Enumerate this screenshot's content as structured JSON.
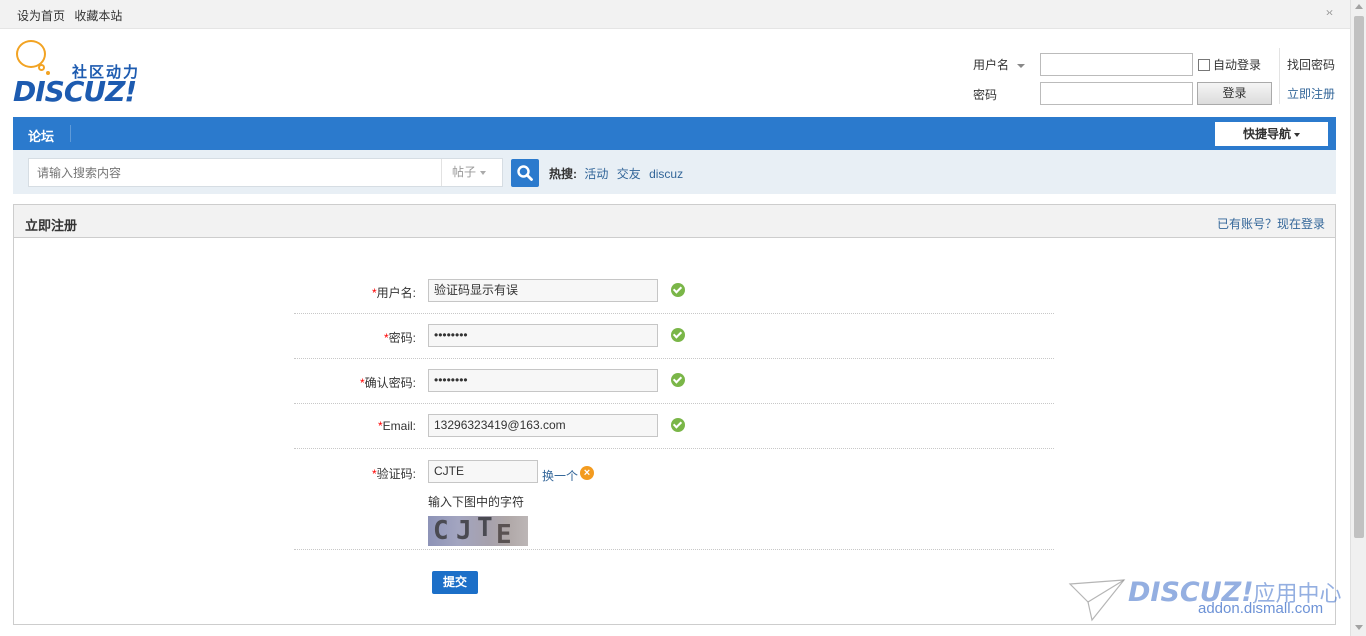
{
  "topbar": {
    "links": [
      "设为首页",
      "收藏本站"
    ],
    "collapse_glyph": "›‹"
  },
  "logo": {
    "cn_text": "社区动力",
    "en_text": "DISCUZ!",
    "brand_color": "#1d5bb0",
    "bubble_color": "#f2a323"
  },
  "login": {
    "username_label": "用户名",
    "password_label": "密码",
    "username_value": "",
    "password_value": "",
    "auto_login_label": "自动登录",
    "login_button": "登录",
    "find_password": "找回密码",
    "register_link": "立即注册"
  },
  "nav": {
    "forum_label": "论坛",
    "quick_nav_label": "快捷导航",
    "bg_color": "#2b7acd"
  },
  "search": {
    "placeholder": "请输入搜索内容",
    "type_label": "帖子",
    "hot_label": "热搜:",
    "hot_links": [
      "活动",
      "交友",
      "discuz"
    ]
  },
  "register": {
    "title": "立即注册",
    "have_account": "已有账号？现在登录",
    "fields": {
      "username": {
        "label": "用户名:",
        "value": "验证码显示有误"
      },
      "password": {
        "label": "密码:",
        "value": "••••••••"
      },
      "confirm": {
        "label": "确认密码:",
        "value": "••••••••"
      },
      "email": {
        "label": "Email:",
        "value": "13296323419@163.com"
      },
      "captcha": {
        "label": "验证码:",
        "value": "CJTE",
        "change": "换一个",
        "hint": "输入下图中的字符",
        "image_chars": [
          "C",
          "J",
          "T",
          "E"
        ]
      }
    },
    "required_mark": "*",
    "submit": "提交"
  },
  "watermark": {
    "logo_text": "DISCUZ!",
    "cn_text": "应用中心",
    "url": "addon.dismall.com"
  }
}
